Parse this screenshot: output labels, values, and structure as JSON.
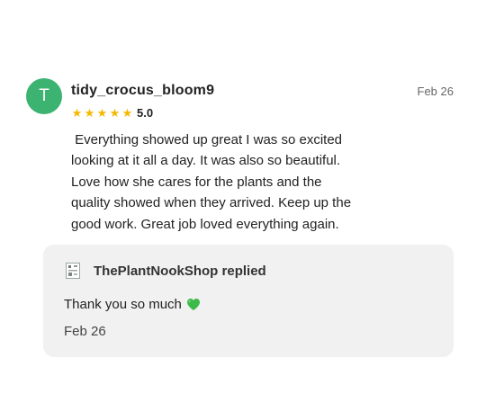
{
  "review": {
    "avatar_initial": "T",
    "username": "tidy_crocus_bloom9",
    "date": "Feb 26",
    "stars": [
      "★",
      "★",
      "★",
      "★",
      "★"
    ],
    "rating": "5.0",
    "body": " Everything showed up great I was so excited\nlooking at it all a day. It was also so beautiful.\nLove how she cares for the plants and the\nquality showed when they arrived. Keep up the\ngood work. Great job loved everything again."
  },
  "reply": {
    "shop_name": "ThePlantNookShop",
    "replied_label": "replied",
    "text": "Thank you so much",
    "date": "Feb 26"
  },
  "colors": {
    "avatar": "#3cb371",
    "star": "#f5b800",
    "reply_bg": "#f1f1f1",
    "heart": "#3dbb4a"
  },
  "icons": {
    "shop_logo": "shop-logo-icon",
    "heart": "green-heart-icon",
    "star": "star-icon"
  }
}
